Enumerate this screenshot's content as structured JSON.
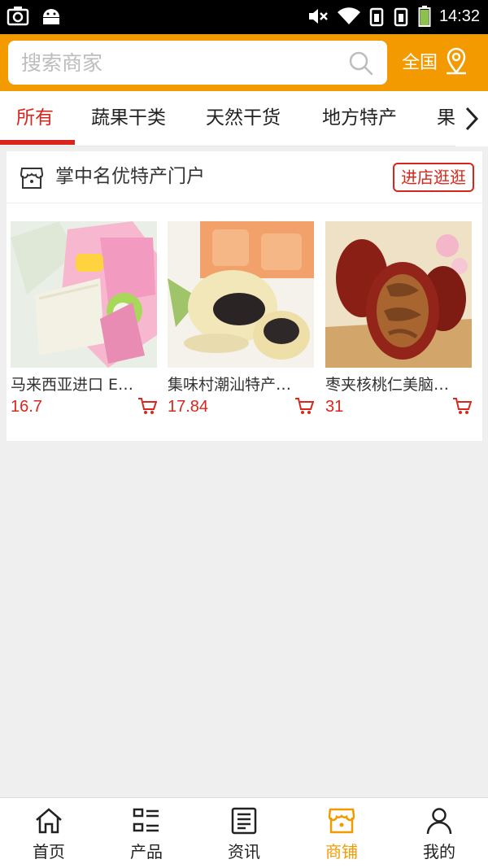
{
  "status_bar": {
    "time": "14:32"
  },
  "header": {
    "search_placeholder": "搜索商家",
    "region_label": "全国"
  },
  "tabs": [
    {
      "label": "所有",
      "active": true
    },
    {
      "label": "蔬果干类"
    },
    {
      "label": "天然干货"
    },
    {
      "label": "地方特产"
    },
    {
      "label": "果"
    }
  ],
  "store": {
    "name": "掌中名优特产门户",
    "visit_label": "进店逛逛",
    "products": [
      {
        "name": "马来西亚进口 EGO椰子软糖",
        "name_display": "马来西亚进口 EG…",
        "price": "16.7"
      },
      {
        "name": "集味村潮汕特产",
        "name_display": "集味村潮汕特产…",
        "price": "17.84"
      },
      {
        "name": "枣夹核桃仁美脑",
        "name_display": "枣夹核桃仁美脑…",
        "price": "31"
      }
    ]
  },
  "bottom_nav": [
    {
      "label": "首页",
      "icon": "home-icon"
    },
    {
      "label": "产品",
      "icon": "grid-list-icon"
    },
    {
      "label": "资讯",
      "icon": "news-icon"
    },
    {
      "label": "商铺",
      "icon": "shop-icon",
      "active": true
    },
    {
      "label": "我的",
      "icon": "user-icon"
    }
  ],
  "colors": {
    "accent": "#f39a00",
    "brand_red": "#d9261c"
  }
}
